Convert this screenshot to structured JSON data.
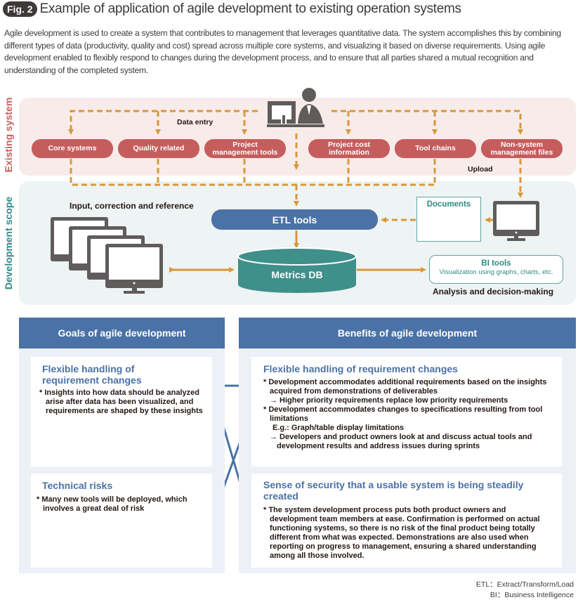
{
  "header": {
    "fig_label": "Fig. 2",
    "title": "Example of application of agile development to existing operation systems",
    "intro": "Agile development is used to create a system that contributes to management that leverages quantitative data. The system accomplishes this by combining different types of data (productivity, quality and cost) spread across multiple core systems, and visualizing it based on diverse requirements. Using agile development enabled to flexibly respond to changes during the development process, and to ensure that all parties shared a mutual recognition and understanding of the completed system."
  },
  "diagram": {
    "existing_label": "Existing system",
    "dev_label": "Development scope",
    "data_entry_label": "Data entry",
    "upload_label": "Upload",
    "existing_systems": [
      {
        "line1": "Core systems",
        "line2": ""
      },
      {
        "line1": "Quality related",
        "line2": ""
      },
      {
        "line1": "Project",
        "line2": "management tools"
      },
      {
        "line1": "Project cost",
        "line2": "information"
      },
      {
        "line1": "Tool chains",
        "line2": ""
      },
      {
        "line1": "Non-system",
        "line2": "management files"
      }
    ],
    "input_label": "Input, correction and reference",
    "etl_label": "ETL tools",
    "documents_label": "Documents",
    "metrics_db_label": "Metrics DB",
    "bi_title": "BI tools",
    "bi_sub": "Visualization using graphs, charts, etc.",
    "analysis_label": "Analysis and decision-making",
    "colors": {
      "existing_band": "#f8ecea",
      "existing_pill": "#c65d5d",
      "dev_band": "#eef3f3",
      "etl": "#4a72a6",
      "db": "#3f8f8a",
      "arrow": "#d9983a",
      "icon_gray": "#5f5c5b"
    }
  },
  "goals": {
    "heading": "Goals of agile development",
    "cards": [
      {
        "title_line1": "Flexible handling of",
        "title_line2": "requirement changes",
        "bullets": [
          "* Insights into how data should be analyzed arise after data has been visualized, and requirements are shaped by these insights"
        ]
      },
      {
        "title_line1": "Technical risks",
        "title_line2": "",
        "bullets": [
          "* Many new tools will be deployed, which involves a great deal of risk"
        ]
      }
    ]
  },
  "benefits": {
    "heading": "Benefits of agile development",
    "cards": [
      {
        "title": "Flexible handling of requirement changes",
        "b1": "* Development accommodates additional requirements based on the insights acquired from demonstrations of deliverables",
        "b1_sub": "→ Higher priority requirements replace low priority requirements",
        "b2": "* Development accommodates changes to specifications resulting from tool limitations",
        "b2_eg": "E.g.: Graph/table display limitations",
        "b2_sub": "→ Developers and product owners look at and discuss actual tools and development results and address issues during sprints"
      },
      {
        "title": "Sense of security that a usable system is being steadily created",
        "b1": "* The system development process puts both product owners and development team members at ease. Confirmation is performed on actual functioning systems, so there is no risk of the final product being totally different from what was expected. Demonstrations are also used when reporting on progress to management, ensuring a shared understanding among all those involved."
      }
    ]
  },
  "footnotes": {
    "etl": "ETL：Extract/Transform/Load",
    "bi": "BI：Business Intelligence"
  }
}
